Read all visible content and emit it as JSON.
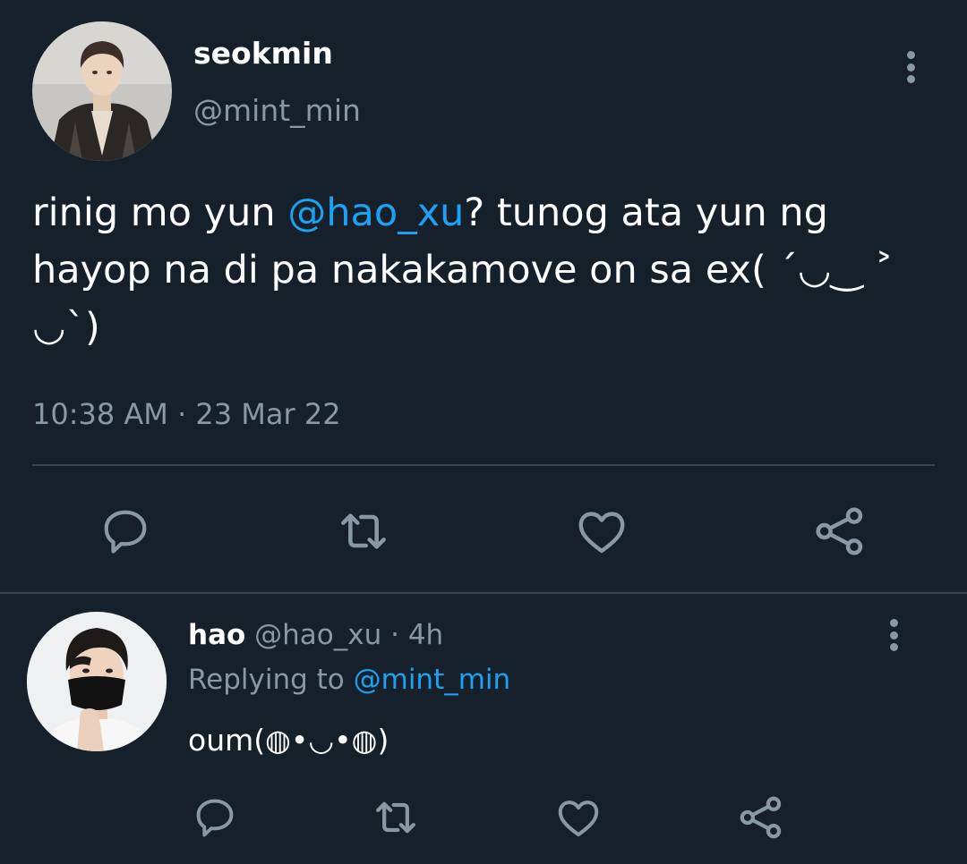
{
  "tweet": {
    "author_name": "seokmin",
    "author_handle": "@mint_min",
    "text_before": "rinig mo yun ",
    "mention": "@hao_xu",
    "text_after": "? tunog ata yun ng\nhayop na di pa nakakamove on sa ex( ˊ◡‿ ˃\n◡ˋ)",
    "time": "10:38 AM",
    "date_sep": " · ",
    "date": "23 Mar 22",
    "actions": [
      "reply-icon",
      "retweet-icon",
      "like-icon",
      "share-icon"
    ]
  },
  "reply": {
    "author_name": "hao",
    "author_handle": "@hao_xu",
    "sep": " · ",
    "time": "4h",
    "replying_label": "Replying to ",
    "replying_to": "@mint_min",
    "text": "oum(◍•◡•◍)",
    "actions": [
      "reply-icon",
      "retweet-icon",
      "like-icon",
      "share-icon"
    ]
  },
  "colors": {
    "background": "#15202b",
    "text": "#ffffff",
    "secondary": "#8899a6",
    "accent": "#1da1f2",
    "divider": "#38444d"
  }
}
